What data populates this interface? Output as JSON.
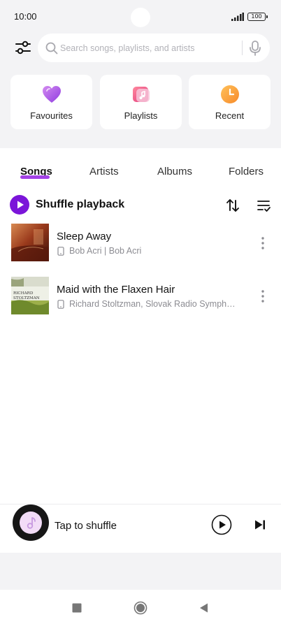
{
  "status_bar": {
    "time": "10:00",
    "battery": "100"
  },
  "search": {
    "placeholder": "Search songs, playlists, and artists"
  },
  "quick_access": [
    {
      "label": "Favourites",
      "icon": "heart-icon"
    },
    {
      "label": "Playlists",
      "icon": "playlist-icon"
    },
    {
      "label": "Recent",
      "icon": "clock-icon"
    }
  ],
  "tabs": [
    {
      "label": "Songs",
      "active": true
    },
    {
      "label": "Artists",
      "active": false
    },
    {
      "label": "Albums",
      "active": false
    },
    {
      "label": "Folders",
      "active": false
    }
  ],
  "shuffle": {
    "label": "Shuffle playback"
  },
  "songs": [
    {
      "title": "Sleep Away",
      "artist": "Bob Acri | Bob Acri"
    },
    {
      "title": "Maid with the Flaxen Hair",
      "artist": "Richard Stoltzman, Slovak Radio Sympho..."
    }
  ],
  "album_art": {
    "text_line1": "RICHARD",
    "text_line2": "STOLTZMAN"
  },
  "mini_player": {
    "label": "Tap to shuffle"
  },
  "colors": {
    "accent": "#7b15d9",
    "tab_underline": "#a342e6",
    "background": "#f3f3f5"
  }
}
